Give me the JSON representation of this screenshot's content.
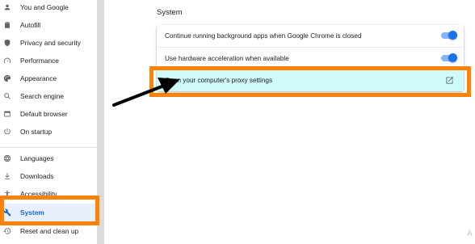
{
  "sidebar": {
    "items": [
      {
        "label": "You and Google",
        "icon": "person-icon"
      },
      {
        "label": "Autofill",
        "icon": "clipboard-icon"
      },
      {
        "label": "Privacy and security",
        "icon": "shield-icon"
      },
      {
        "label": "Performance",
        "icon": "speedometer-icon"
      },
      {
        "label": "Appearance",
        "icon": "palette-icon"
      },
      {
        "label": "Search engine",
        "icon": "search-icon"
      },
      {
        "label": "Default browser",
        "icon": "browser-icon"
      },
      {
        "label": "On startup",
        "icon": "power-icon"
      },
      {
        "label": "Languages",
        "icon": "globe-icon"
      },
      {
        "label": "Downloads",
        "icon": "download-icon"
      },
      {
        "label": "Accessibility",
        "icon": "accessibility-icon"
      },
      {
        "label": "System",
        "icon": "wrench-icon"
      },
      {
        "label": "Reset and clean up",
        "icon": "restore-icon"
      }
    ],
    "active": "System"
  },
  "main": {
    "section_title": "System",
    "settings": [
      {
        "label": "Continue running background apps when Google Chrome is closed",
        "control": "toggle",
        "enabled": true
      },
      {
        "label": "Use hardware acceleration when available",
        "control": "toggle",
        "enabled": true
      },
      {
        "label": "Open your computer's proxy settings",
        "control": "external-link",
        "icon": "open-in-new-icon"
      }
    ]
  },
  "annotations": {
    "highlight_color": "#ff8200",
    "arrow_color": "#000000"
  },
  "corner_text": "A"
}
